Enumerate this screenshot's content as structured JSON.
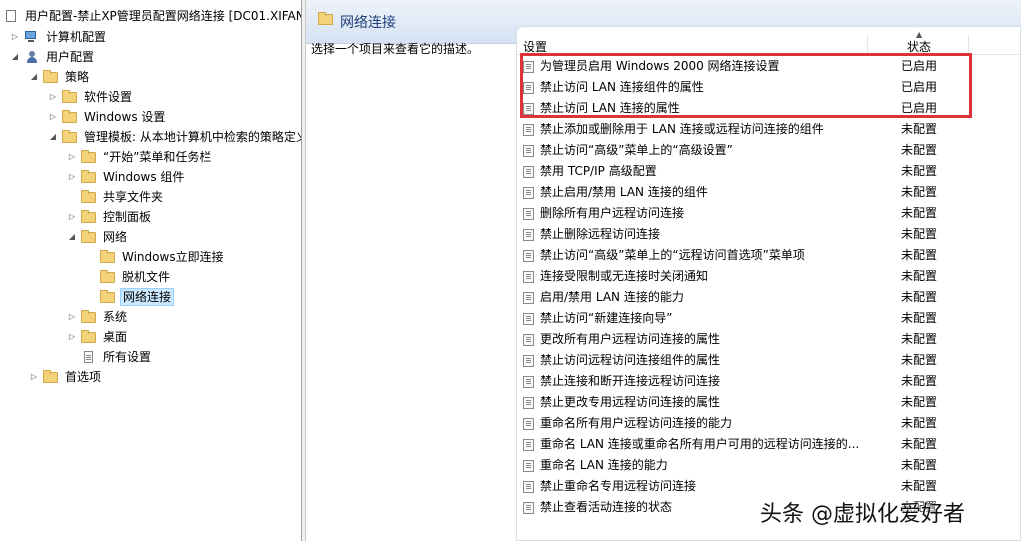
{
  "tree": {
    "title": "用户配置-禁止XP管理员配置网络连接 [DC01.XIFAN",
    "items": [
      {
        "label": "计算机配置"
      },
      {
        "label": "用户配置"
      },
      {
        "label": "策略"
      },
      {
        "label": "软件设置"
      },
      {
        "label": "Windows 设置"
      },
      {
        "label": "管理模板: 从本地计算机中检索的策略定义"
      },
      {
        "label": "“开始”菜单和任务栏"
      },
      {
        "label": "Windows 组件"
      },
      {
        "label": "共享文件夹"
      },
      {
        "label": "控制面板"
      },
      {
        "label": "网络"
      },
      {
        "label": "Windows立即连接"
      },
      {
        "label": "脱机文件"
      },
      {
        "label": "网络连接"
      },
      {
        "label": "系统"
      },
      {
        "label": "桌面"
      },
      {
        "label": "所有设置"
      },
      {
        "label": "首选项"
      }
    ]
  },
  "right": {
    "header_title": "网络连接",
    "description": "选择一个项目来查看它的描述。",
    "col_setting": "设置",
    "col_state": "状态",
    "policies": [
      {
        "name": "为管理员启用 Windows 2000 网络连接设置",
        "state": "已启用"
      },
      {
        "name": "禁止访问 LAN 连接组件的属性",
        "state": "已启用"
      },
      {
        "name": "禁止访问 LAN 连接的属性",
        "state": "已启用"
      },
      {
        "name": "禁止添加或删除用于 LAN 连接或远程访问连接的组件",
        "state": "未配置"
      },
      {
        "name": "禁止访问“高级”菜单上的“高级设置”",
        "state": "未配置"
      },
      {
        "name": "禁用 TCP/IP 高级配置",
        "state": "未配置"
      },
      {
        "name": "禁止启用/禁用 LAN 连接的组件",
        "state": "未配置"
      },
      {
        "name": "删除所有用户远程访问连接",
        "state": "未配置"
      },
      {
        "name": "禁止删除远程访问连接",
        "state": "未配置"
      },
      {
        "name": "禁止访问“高级”菜单上的“远程访问首选项”菜单项",
        "state": "未配置"
      },
      {
        "name": "连接受限制或无连接时关闭通知",
        "state": "未配置"
      },
      {
        "name": "启用/禁用 LAN 连接的能力",
        "state": "未配置"
      },
      {
        "name": "禁止访问“新建连接向导”",
        "state": "未配置"
      },
      {
        "name": "更改所有用户远程访问连接的属性",
        "state": "未配置"
      },
      {
        "name": "禁止访问远程访问连接组件的属性",
        "state": "未配置"
      },
      {
        "name": "禁止连接和断开连接远程访问连接",
        "state": "未配置"
      },
      {
        "name": "禁止更改专用远程访问连接的属性",
        "state": "未配置"
      },
      {
        "name": "重命名所有用户远程访问连接的能力",
        "state": "未配置"
      },
      {
        "name": "重命名 LAN 连接或重命名所有用户可用的远程访问连接的...",
        "state": "未配置"
      },
      {
        "name": "重命名 LAN 连接的能力",
        "state": "未配置"
      },
      {
        "name": "禁止重命名专用远程访问连接",
        "state": "未配置"
      },
      {
        "name": "禁止查看活动连接的状态",
        "state": "未配置"
      }
    ]
  },
  "watermark": "头条 @虚拟化爱好者",
  "colors": {
    "highlight": "#e0303a",
    "selection": "#cce8ff",
    "header_bg": "#d6e2f2"
  }
}
